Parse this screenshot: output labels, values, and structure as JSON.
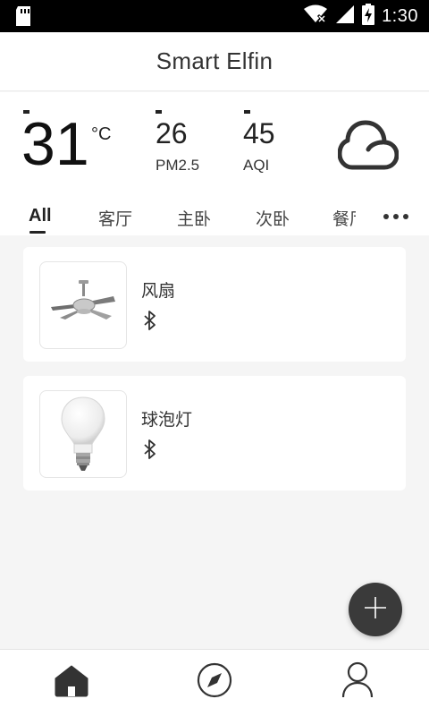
{
  "status_bar": {
    "time": "1:30",
    "icons": [
      "sd-card-icon",
      "wifi-icon",
      "cell-signal-icon",
      "battery-charging-icon"
    ]
  },
  "header": {
    "title": "Smart Elfin"
  },
  "weather": {
    "temperature": "31",
    "unit": "°C",
    "pm25_value": "26",
    "pm25_label": "PM2.5",
    "aqi_value": "45",
    "aqi_label": "AQI",
    "condition_icon": "cloud-icon"
  },
  "tabs": {
    "items": [
      "All",
      "客厅",
      "主卧",
      "次卧",
      "餐厅"
    ],
    "active": "All",
    "more_icon": "more-dots-icon"
  },
  "devices": [
    {
      "name": "风扇",
      "connection_icon": "bluetooth-icon",
      "image": "ceiling-fan"
    },
    {
      "name": "球泡灯",
      "connection_icon": "bluetooth-icon",
      "image": "light-bulb"
    }
  ],
  "fab": {
    "icon": "plus-icon"
  },
  "bottom_nav": [
    {
      "icon": "home-icon",
      "active": true
    },
    {
      "icon": "compass-icon",
      "active": false
    },
    {
      "icon": "user-icon",
      "active": false
    }
  ],
  "colors": {
    "accent": "#3a3a3a",
    "background": "#f5f5f5",
    "card": "#ffffff"
  }
}
